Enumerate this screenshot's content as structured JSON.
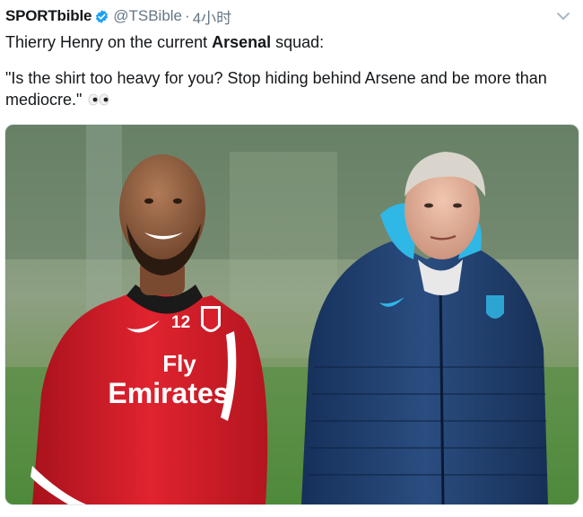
{
  "tweet": {
    "display_name": "SPORTbible",
    "handle": "@TSBible",
    "separator": "·",
    "time": "4小时",
    "line1_before": "Thierry Henry on the current ",
    "line1_bold": "Arsenal",
    "line1_after": " squad:",
    "quote": "\"Is the shirt too heavy for you? Stop hiding behind Arsene and be more than mediocre.\""
  },
  "photo": {
    "shirt_number": "12",
    "sponsor_line1": "Fly",
    "sponsor_line2": "Emirates"
  },
  "icons": {
    "verified": "verified-badge-icon",
    "chevron": "chevron-down-icon",
    "eyes": "eyes-emoji-icon"
  },
  "colors": {
    "verified_blue": "#1da1f2",
    "muted_text": "#657786",
    "kit_red": "#d8202c",
    "jacket_navy": "#1f3d6b"
  }
}
